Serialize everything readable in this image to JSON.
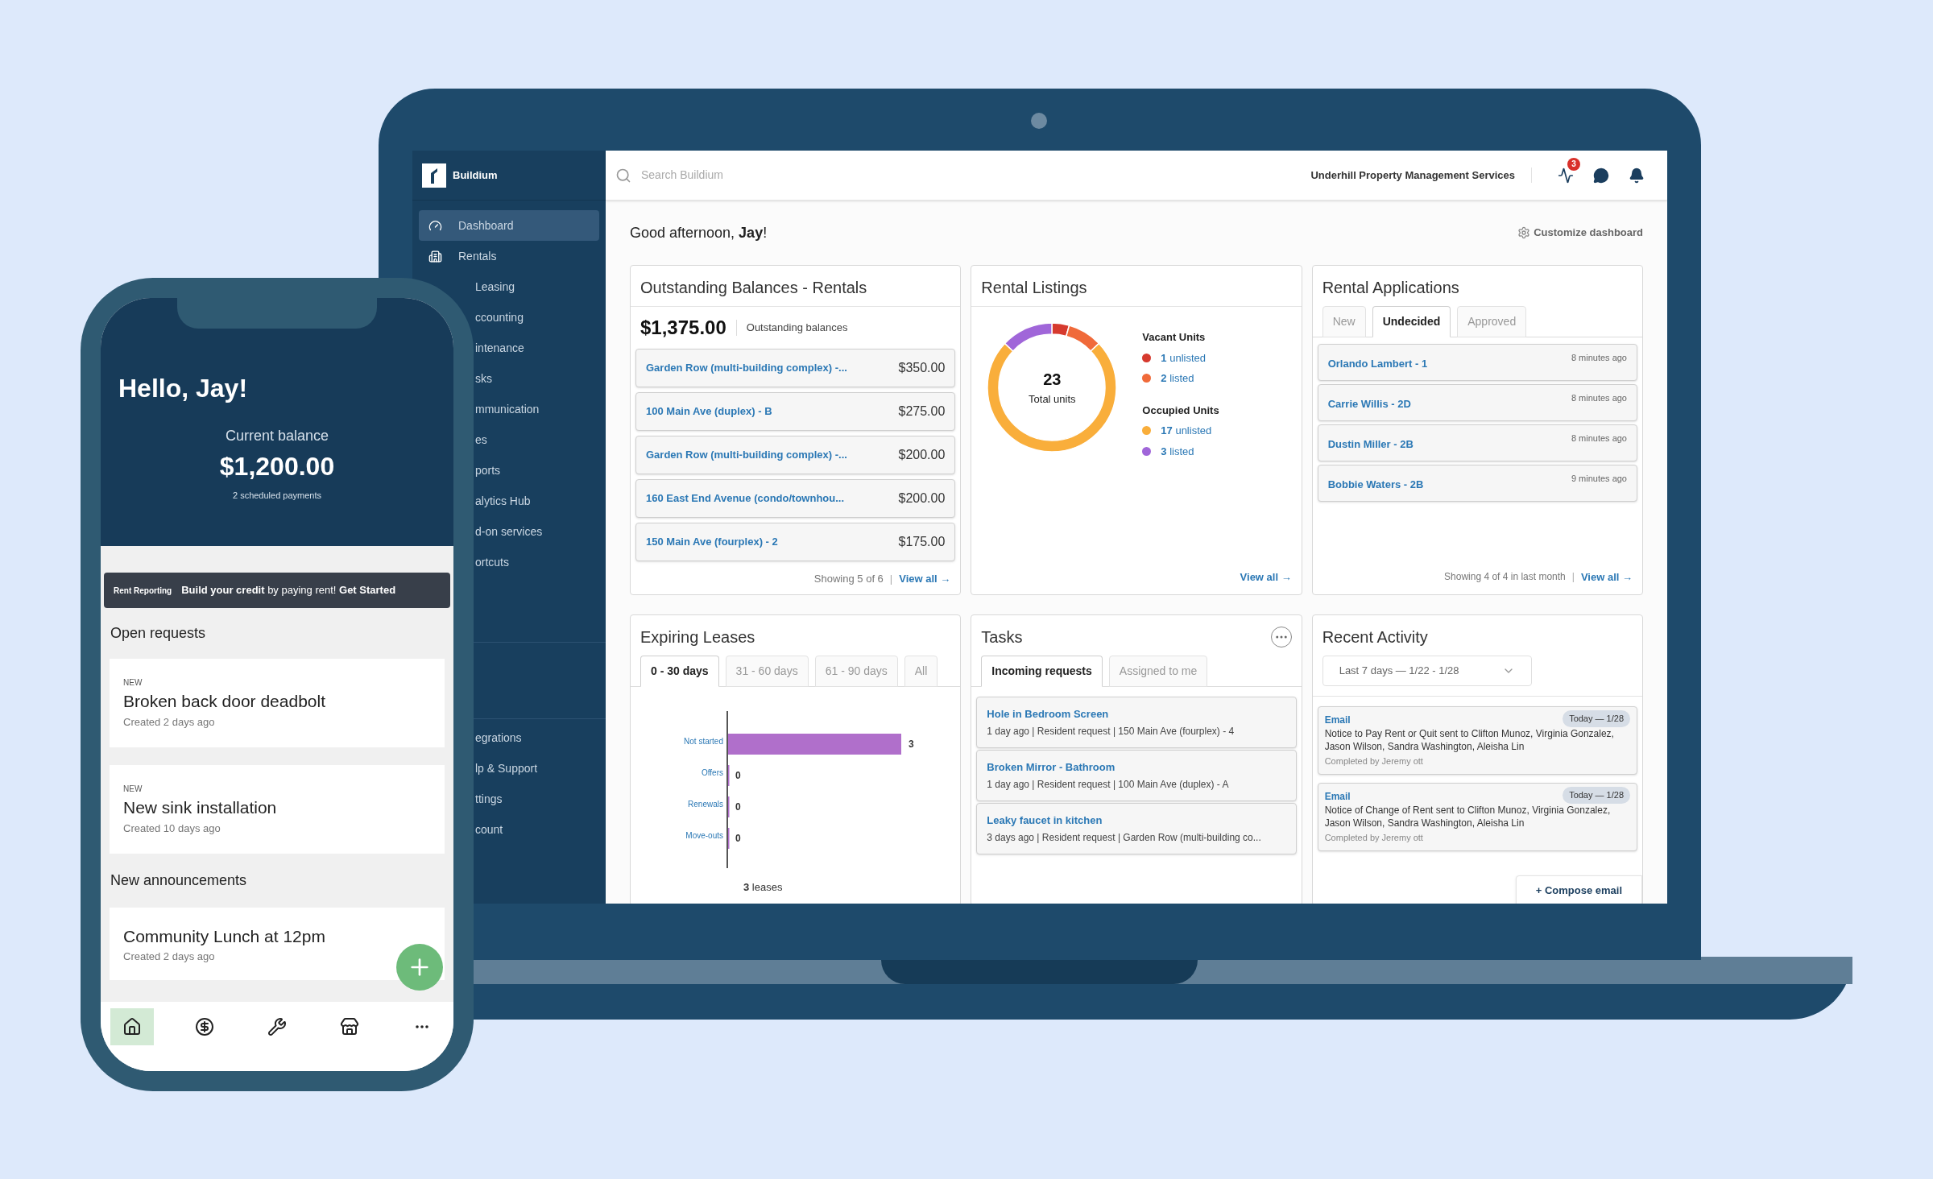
{
  "laptop": {
    "sidebar": {
      "logo": "Buildium",
      "items": [
        {
          "label": "Dashboard",
          "selected": true,
          "kind": "full"
        },
        {
          "label": "Rentals",
          "selected": false,
          "kind": "full"
        },
        {
          "label": "Leasing",
          "selected": false,
          "kind": "partial"
        },
        {
          "label": "ccounting",
          "selected": false,
          "kind": "partial"
        },
        {
          "label": "intenance",
          "selected": false,
          "kind": "partial"
        },
        {
          "label": "sks",
          "selected": false,
          "kind": "partial"
        },
        {
          "label": "mmunication",
          "selected": false,
          "kind": "partial"
        },
        {
          "label": "es",
          "selected": false,
          "kind": "partial"
        },
        {
          "label": "ports",
          "selected": false,
          "kind": "partial"
        },
        {
          "label": "alytics Hub",
          "selected": false,
          "kind": "partial"
        },
        {
          "label": "d-on services",
          "selected": false,
          "kind": "partial"
        },
        {
          "label": "ortcuts",
          "selected": false,
          "kind": "partial"
        }
      ],
      "bottom_items": [
        {
          "label": "egrations",
          "selected": false,
          "kind": "partial"
        },
        {
          "label": "lp & Support",
          "selected": false,
          "kind": "partial"
        },
        {
          "label": "ttings",
          "selected": false,
          "kind": "partial"
        },
        {
          "label": "count",
          "selected": false,
          "kind": "partial"
        }
      ]
    },
    "topbar": {
      "search": {
        "placeholder": "Search Buildium"
      },
      "company": "Underhill Property Management Services",
      "activity_badge": "3"
    },
    "greeting": "Good afternoon, **Jay**!",
    "customize": "Customize dashboard",
    "outstanding": {
      "title": "Outstanding Balances - Rentals",
      "total": "$1,375.00",
      "total_label": "Outstanding balances",
      "rows": [
        {
          "name": "Garden Row (multi-building complex) -...",
          "amount": "$350.00"
        },
        {
          "name": "100 Main Ave (duplex) - B",
          "amount": "$275.00"
        },
        {
          "name": "Garden Row (multi-building complex) -...",
          "amount": "$200.00"
        },
        {
          "name": "160 East End Avenue (condo/townhou...",
          "amount": "$200.00"
        },
        {
          "name": "150 Main Ave (fourplex) - 2",
          "amount": "$175.00"
        }
      ],
      "footer": "Showing 5 of 6",
      "separator": "|",
      "view_all": "View all →"
    },
    "listings": {
      "title": "Rental Listings",
      "center_value": "23",
      "center_label": "Total units",
      "chart_data": {
        "type": "donut",
        "categories": [
          "**1** unlisted",
          "**2** listed",
          "**17** unlisted",
          "**3** listed"
        ],
        "values": [
          1,
          2,
          17,
          3
        ]
      },
      "groups": [
        {
          "title": "Vacant Units",
          "items": [
            {
              "color": "#d63a2e"
            },
            {
              "color": "#f06a3a"
            }
          ]
        },
        {
          "title": "Occupied Units",
          "items": [
            {
              "color": "#f9ae3b"
            },
            {
              "color": "#a066d9"
            }
          ]
        }
      ],
      "view_all": "View all →"
    },
    "applications": {
      "title": "Rental Applications",
      "tabs": [
        {
          "label": "New",
          "selected": false
        },
        {
          "label": "Undecided",
          "selected": true
        },
        {
          "label": "Approved",
          "selected": false
        }
      ],
      "rows": [
        {
          "name": "Orlando Lambert - 1",
          "time": "8 minutes ago"
        },
        {
          "name": "Carrie Willis - 2D",
          "time": "8 minutes ago"
        },
        {
          "name": "Dustin Miller - 2B",
          "time": "8 minutes ago"
        },
        {
          "name": "Bobbie Waters - 2B",
          "time": "9 minutes ago"
        }
      ],
      "footer": "Showing 4 of 4 in last month",
      "separator": "|",
      "view_all": "View all →"
    },
    "leases": {
      "title": "Expiring Leases",
      "tabs": [
        {
          "label": "0 - 30 days",
          "selected": true
        },
        {
          "label": "31 - 60 days",
          "selected": false
        },
        {
          "label": "61 - 90 days",
          "selected": false
        },
        {
          "label": "All",
          "selected": false
        }
      ],
      "chart_data": {
        "type": "bar",
        "orientation": "horizontal",
        "categories": [
          "Not started",
          "Offers",
          "Renewals",
          "Move-outs"
        ],
        "values": [
          3,
          0,
          0,
          0
        ],
        "data_labels": true,
        "xlabel": "**3** leases"
      }
    },
    "tasks": {
      "title": "Tasks",
      "tabs": [
        {
          "label": "Incoming requests",
          "selected": true
        },
        {
          "label": "Assigned to me",
          "selected": false
        }
      ],
      "rows": [
        {
          "title": "Hole in Bedroom Screen",
          "detail": "1 day ago | Resident request | 150 Main Ave (fourplex) - 4"
        },
        {
          "title": "Broken Mirror - Bathroom",
          "detail": "1 day ago | Resident request | 100 Main Ave (duplex) - A"
        },
        {
          "title": "Leaky faucet in kitchen",
          "detail": "3 days ago | Resident request | Garden Row (multi-building co..."
        }
      ]
    },
    "activity": {
      "title": "Recent Activity",
      "range": "Last 7 days — 1/22 - 1/28",
      "items": [
        {
          "type": "Email",
          "date": "Today — 1/28",
          "text": "Notice to Pay Rent or Quit sent to Clifton Munoz, Virginia Gonzalez, Jason Wilson, Sandra Washington, Aleisha Lin",
          "by": "Completed by Jeremy ott"
        },
        {
          "type": "Email",
          "date": "Today — 1/28",
          "text": "Notice of Change of Rent sent to Clifton Munoz, Virginia Gonzalez, Jason Wilson, Sandra Washington, Aleisha Lin",
          "by": "Completed by Jeremy ott"
        }
      ],
      "compose": "+ Compose email"
    }
  },
  "phone": {
    "hello": "Hello, Jay!",
    "balance_label": "Current balance",
    "balance": "$1,200.00",
    "scheduled": "2 scheduled payments",
    "banner": {
      "brand": "Rent Reporting",
      "text": "**Build your credit** by paying rent! **Get Started**"
    },
    "open_requests": {
      "title": "Open requests",
      "items": [
        {
          "tag": "NEW",
          "title": "Broken back door deadbolt",
          "created": "Created 2 days ago"
        },
        {
          "tag": "NEW",
          "title": "New sink installation",
          "created": "Created 10 days ago"
        }
      ]
    },
    "announcements": {
      "title": "New announcements",
      "items": [
        {
          "title": "Community Lunch at 12pm",
          "created": "Created 2 days ago"
        }
      ]
    },
    "nav": [
      {
        "selected": true
      },
      {
        "selected": false
      },
      {
        "selected": false
      },
      {
        "selected": false
      },
      {
        "selected": false
      }
    ]
  }
}
